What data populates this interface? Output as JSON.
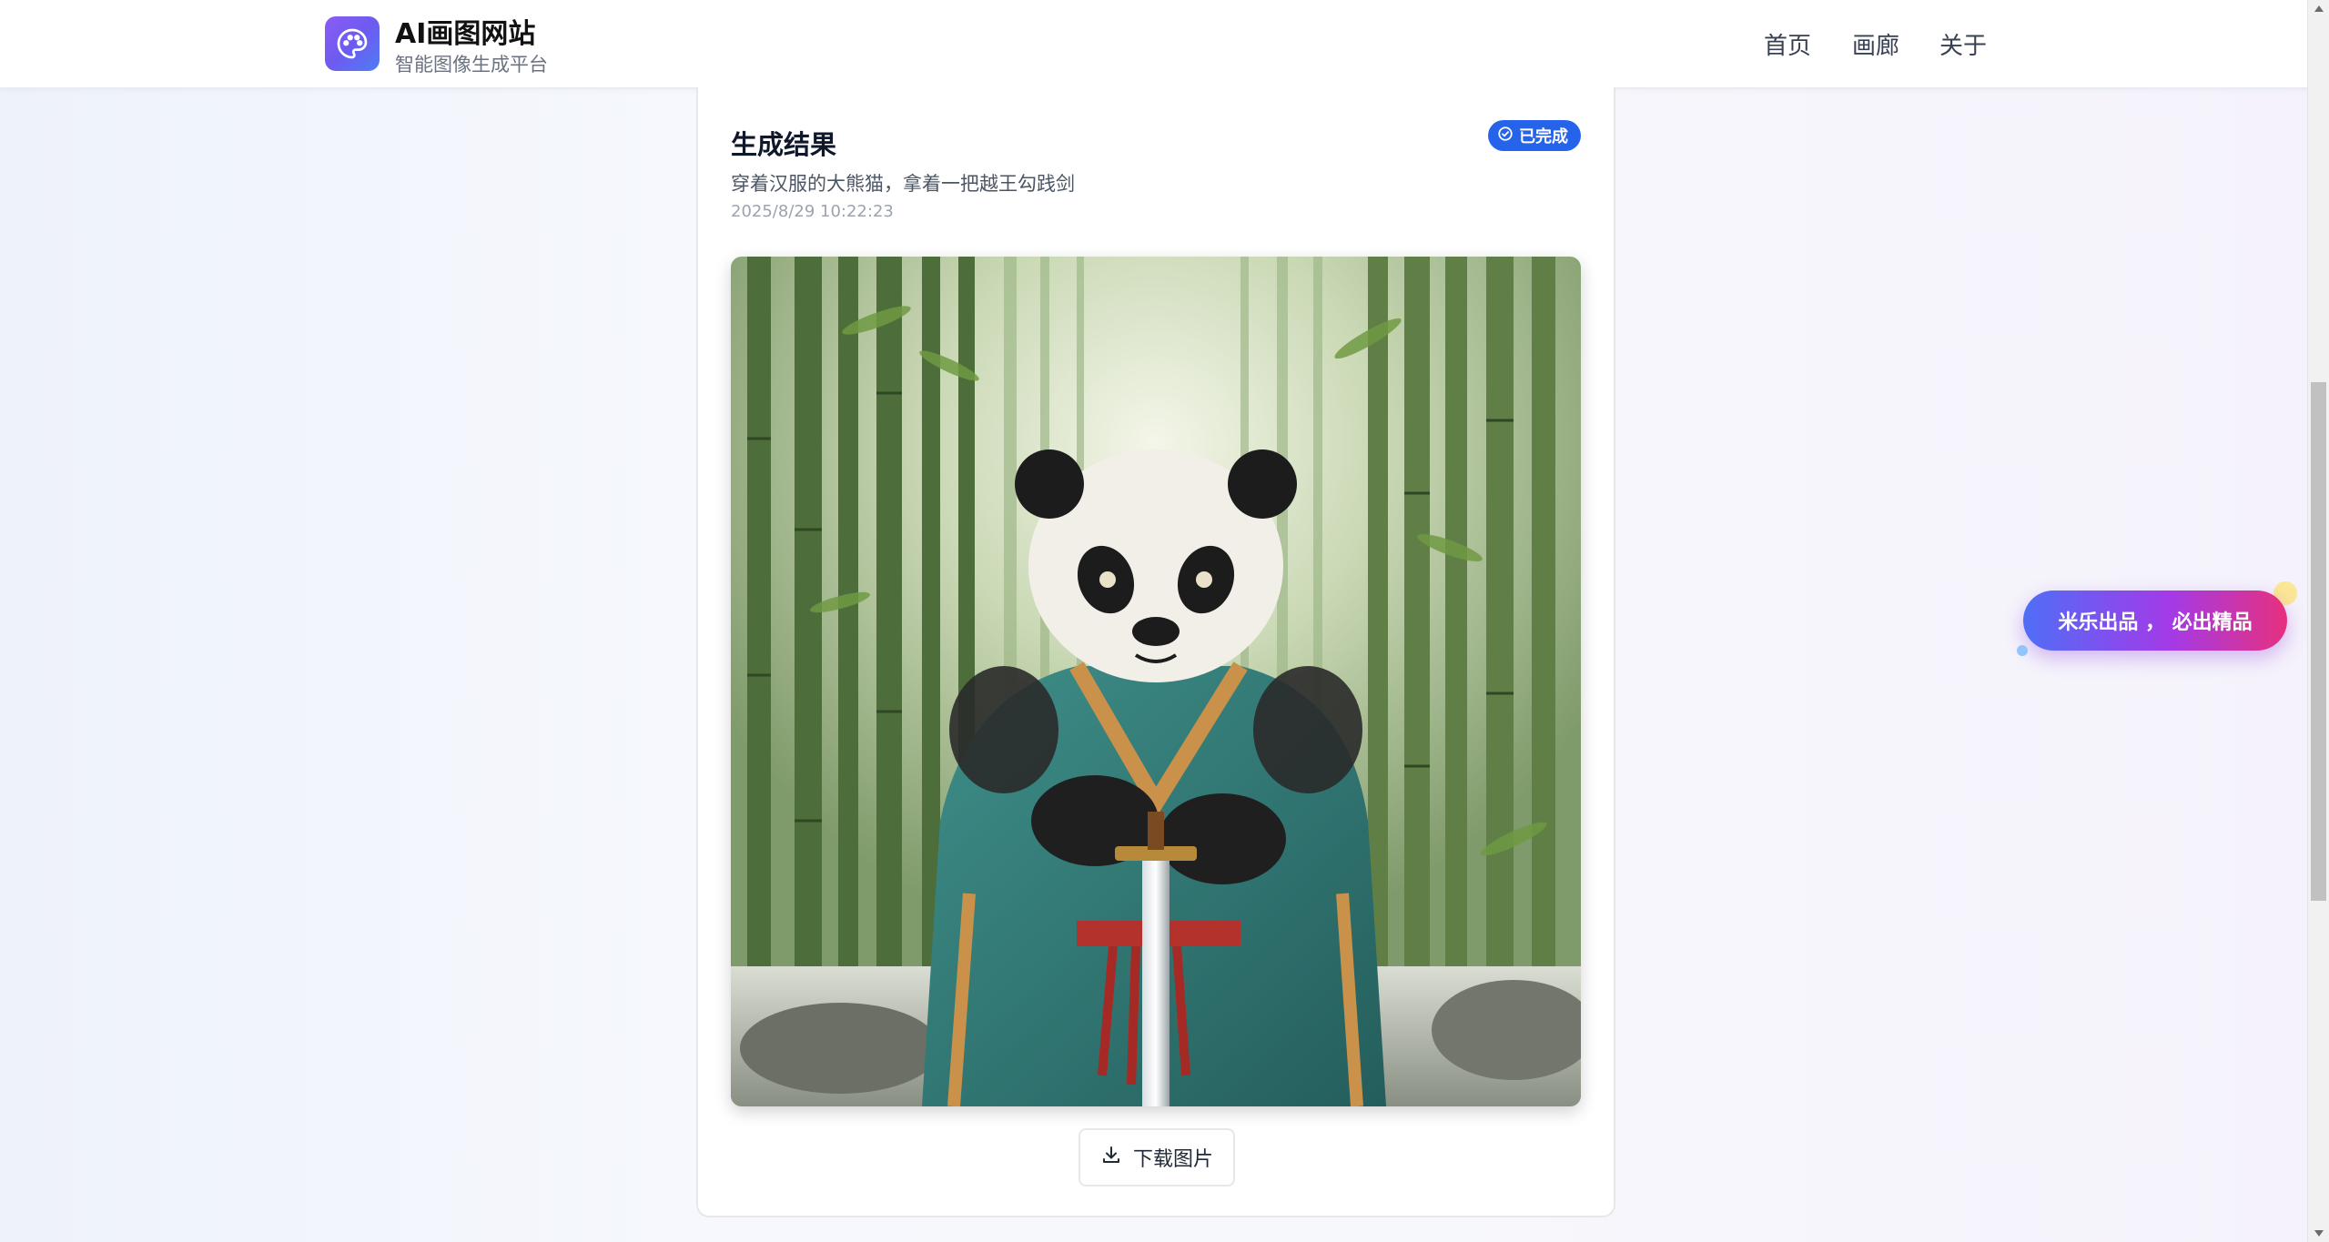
{
  "header": {
    "title": "AI画图网站",
    "subtitle": "智能图像生成平台",
    "nav": [
      {
        "label": "首页"
      },
      {
        "label": "画廊"
      },
      {
        "label": "关于"
      }
    ]
  },
  "result": {
    "title": "生成结果",
    "status": "已完成",
    "prompt": "穿着汉服的大熊猫，拿着一把越王勾践剑",
    "timestamp": "2025/8/29 10:22:23",
    "download_label": "下载图片"
  },
  "promo": {
    "label": "米乐出品 ， 必出精品"
  },
  "colors": {
    "accent": "#2563eb",
    "logo_gradient_start": "#8b5cf6",
    "logo_gradient_end": "#4f7cf5",
    "promo_gradient_start": "#4f6ef7",
    "promo_gradient_end": "#e7307e"
  },
  "icons": {
    "logo": "palette-icon",
    "status": "check-circle-icon",
    "download": "download-icon"
  }
}
